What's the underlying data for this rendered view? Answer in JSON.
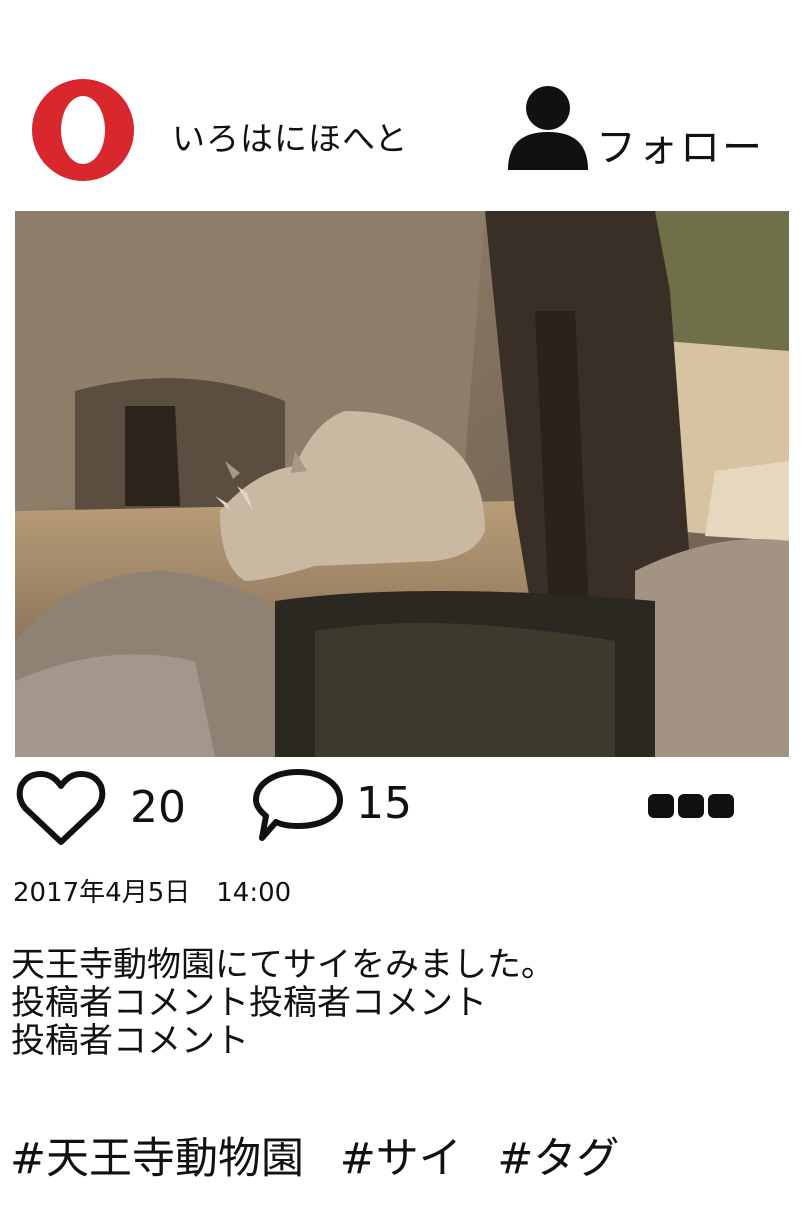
{
  "header": {
    "username": "いろはにほへと",
    "follow_label": "フォロー"
  },
  "post": {
    "image_alt": "",
    "likes": "20",
    "comments": "15",
    "date": "2017年4月5日　14:00",
    "caption_lines": [
      "天王寺動物園にてサイをみました。",
      "投稿者コメント投稿者コメント",
      "投稿者コメント"
    ],
    "tags": [
      "#天王寺動物園",
      "#サイ",
      "#タグ"
    ]
  },
  "colors": {
    "avatar_red": "#d8282e",
    "icon_black": "#111111"
  }
}
